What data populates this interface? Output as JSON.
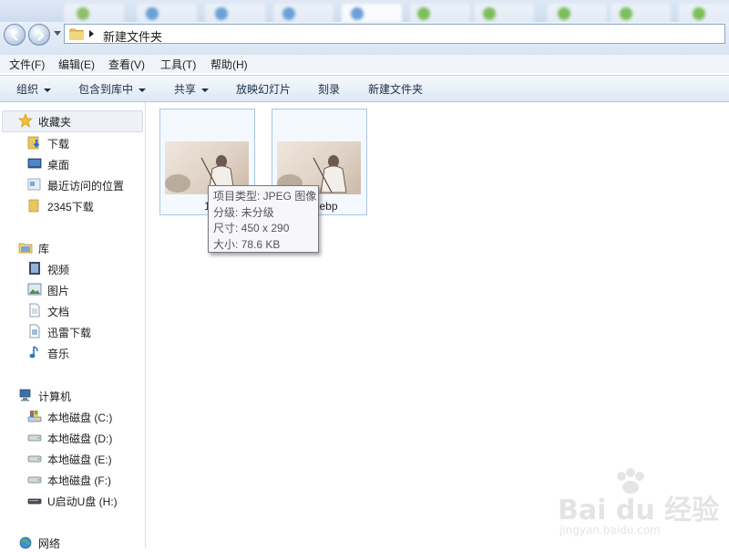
{
  "address": {
    "path": "新建文件夹"
  },
  "menu": [
    "文件(F)",
    "编辑(E)",
    "查看(V)",
    "工具(T)",
    "帮助(H)"
  ],
  "toolbar": {
    "organize": "组织",
    "include_in_library": "包含到库中",
    "share": "共享",
    "slideshow": "放映幻灯片",
    "burn": "刻录",
    "new_folder": "新建文件夹"
  },
  "sidebar": {
    "favorites": {
      "title": "收藏夹",
      "items": [
        {
          "label": "下载",
          "icon": "download-folder-icon"
        },
        {
          "label": "桌面",
          "icon": "desktop-icon"
        },
        {
          "label": "最近访问的位置",
          "icon": "recent-places-icon"
        },
        {
          "label": "2345下载",
          "icon": "folder-icon"
        }
      ]
    },
    "libraries": {
      "title": "库",
      "items": [
        {
          "label": "视频",
          "icon": "video-icon"
        },
        {
          "label": "图片",
          "icon": "picture-icon"
        },
        {
          "label": "文档",
          "icon": "document-icon"
        },
        {
          "label": "迅雷下载",
          "icon": "thunder-icon"
        },
        {
          "label": "音乐",
          "icon": "music-icon"
        }
      ]
    },
    "computer": {
      "title": "计算机",
      "items": [
        {
          "label": "本地磁盘 (C:)",
          "icon": "system-drive-icon"
        },
        {
          "label": "本地磁盘 (D:)",
          "icon": "drive-icon"
        },
        {
          "label": "本地磁盘 (E:)",
          "icon": "drive-icon"
        },
        {
          "label": "本地磁盘 (F:)",
          "icon": "drive-icon"
        },
        {
          "label": "U启动U盘 (H:)",
          "icon": "usb-drive-icon"
        }
      ]
    },
    "network": {
      "title": "网络"
    }
  },
  "files": [
    {
      "label": "1"
    },
    {
      "label": "ebp"
    }
  ],
  "tooltip": {
    "type": "项目类型: JPEG 图像",
    "rating": "分级: 未分级",
    "dimensions": "尺寸: 450 x 290",
    "size": "大小: 78.6 KB"
  },
  "watermark": {
    "brand": "Bai du 经验",
    "url": "jingyan.baidu.com"
  }
}
